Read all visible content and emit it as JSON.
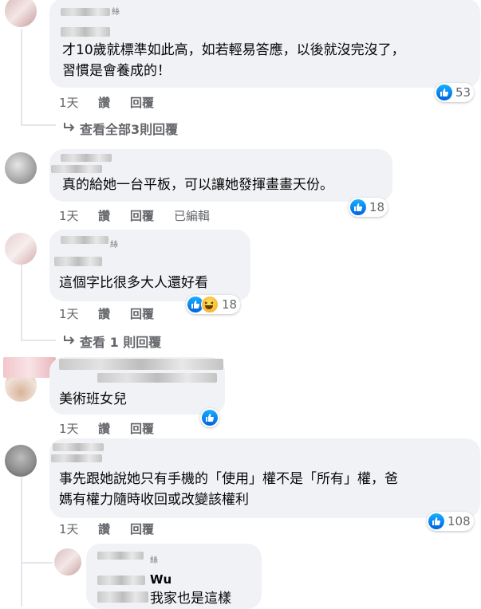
{
  "comments": [
    {
      "name_suffix": "絲",
      "text_lines": [
        "才10歲就標準如此高，如若輕易答應，以後就沒完沒了，",
        "習慣是會養成的！"
      ],
      "time": "1天",
      "like_label": "讚",
      "reply_label": "回覆",
      "edited": "",
      "reactions": [
        "like"
      ],
      "reaction_count": "53",
      "view_replies": "查看全部3則回覆"
    },
    {
      "name_suffix": "",
      "text_lines": [
        "真的給她一台平板，可以讓她發揮畫畫天份。"
      ],
      "time": "1天",
      "like_label": "讚",
      "reply_label": "回覆",
      "edited": "已編輯",
      "reactions": [
        "like"
      ],
      "reaction_count": "18",
      "view_replies": ""
    },
    {
      "name_suffix": "絲",
      "text_lines": [
        "這個字比很多大人還好看"
      ],
      "time": "1天",
      "like_label": "讚",
      "reply_label": "回覆",
      "edited": "",
      "reactions": [
        "like",
        "haha"
      ],
      "reaction_count": "18",
      "view_replies": "查看 1 則回覆"
    },
    {
      "name_suffix": "",
      "text_lines": [
        "美術班女兒"
      ],
      "time": "1天",
      "like_label": "讚",
      "reply_label": "回覆",
      "edited": "",
      "reactions": [
        "like"
      ],
      "reaction_count": "",
      "view_replies": ""
    },
    {
      "name_suffix": "",
      "text_lines": [
        "事先跟她說她只有手機的「使用」權不是「所有」權，爸",
        "媽有權力隨時收回或改變該權利"
      ],
      "time": "1天",
      "like_label": "讚",
      "reply_label": "回覆",
      "edited": "",
      "reactions": [
        "like"
      ],
      "reaction_count": "108",
      "view_replies": ""
    }
  ],
  "reply": {
    "name_suffix": "絲",
    "name_partial": "Wu",
    "text": "我家也是這樣"
  },
  "colors": {
    "bubble": "#f0f2f5",
    "meta": "#65676b",
    "like_blue": "#0866ff"
  },
  "icons": {
    "like": "thumbs-up-icon",
    "haha": "haha-face-icon",
    "reply_arrow": "reply-arrow-icon"
  }
}
